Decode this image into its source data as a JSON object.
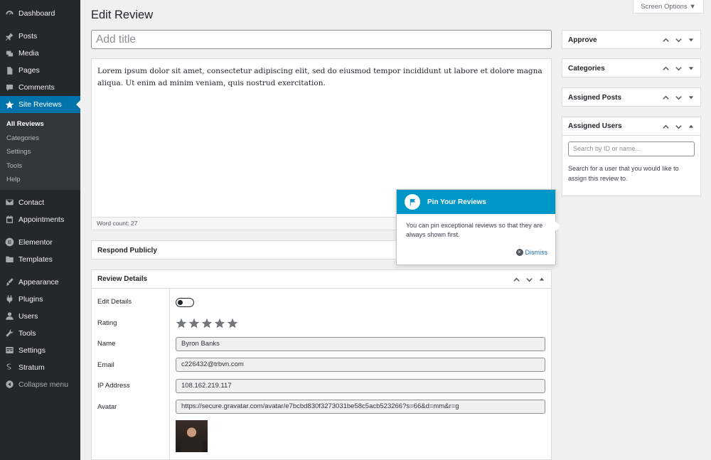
{
  "sidebar": {
    "items": [
      {
        "label": "Dashboard",
        "icon": "dashboard-icon"
      },
      {
        "label": "Posts",
        "icon": "pin-icon"
      },
      {
        "label": "Media",
        "icon": "media-icon"
      },
      {
        "label": "Pages",
        "icon": "pages-icon"
      },
      {
        "label": "Comments",
        "icon": "comments-icon"
      },
      {
        "label": "Site Reviews",
        "icon": "star-icon"
      }
    ],
    "submenu": [
      "All Reviews",
      "Categories",
      "Settings",
      "Tools",
      "Help"
    ],
    "items2": [
      {
        "label": "Contact",
        "icon": "mail-icon"
      },
      {
        "label": "Appointments",
        "icon": "calendar-icon"
      }
    ],
    "items3": [
      {
        "label": "Elementor",
        "icon": "elementor-icon"
      },
      {
        "label": "Templates",
        "icon": "folder-icon"
      }
    ],
    "items4": [
      {
        "label": "Appearance",
        "icon": "brush-icon"
      },
      {
        "label": "Plugins",
        "icon": "plugin-icon"
      },
      {
        "label": "Users",
        "icon": "user-icon"
      },
      {
        "label": "Tools",
        "icon": "wrench-icon"
      },
      {
        "label": "Settings",
        "icon": "settings-icon"
      },
      {
        "label": "Stratum",
        "icon": "stratum-icon"
      },
      {
        "label": "Collapse menu",
        "icon": "collapse-icon"
      }
    ]
  },
  "header": {
    "title": "Edit Review",
    "screen_options": "Screen Options ▼"
  },
  "title_input": {
    "placeholder": "Add title"
  },
  "editor": {
    "content": "Lorem ipsum dolor sit amet, consectetur adipiscing elit, sed do eiusmod tempor incididunt ut labore et dolore magna aliqua. Ut enim ad minim veniam, quis nostrud exercitation.",
    "word_count": "Word count: 27"
  },
  "respond_publicly": {
    "title": "Respond Publicly"
  },
  "review_details": {
    "title": "Review Details",
    "labels": {
      "edit_details": "Edit Details",
      "rating": "Rating",
      "name": "Name",
      "email": "Email",
      "ip": "IP Address",
      "avatar": "Avatar"
    },
    "values": {
      "edit_details_on": false,
      "rating": 5,
      "name": "Byron Banks",
      "email": "c226432@trbvn.com",
      "ip": "108.162.219.117",
      "avatar_url": "https://secure.gravatar.com/avatar/e7bcbd830f3273031be58c5acb523266?s=66&d=mm&r=g"
    }
  },
  "pointer": {
    "title": "Pin Your Reviews",
    "body": "You can pin exceptional reviews so that they are always shown first.",
    "dismiss": "Dismiss"
  },
  "side_boxes": {
    "approve": "Approve",
    "categories": "Categories",
    "assigned_posts": "Assigned Posts",
    "assigned_users": "Assigned Users",
    "user_search_placeholder": "Search by ID or name...",
    "user_help": "Search for a user that you would like to assign this review to."
  },
  "colors": {
    "sidebar_bg": "#23282d",
    "active": "#0073aa",
    "pointer_header": "#0096c8",
    "page_bg": "#f0f0f1"
  }
}
